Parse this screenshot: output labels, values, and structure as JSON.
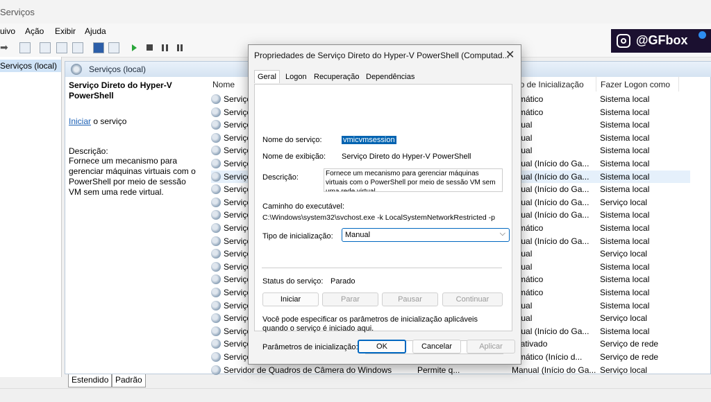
{
  "window": {
    "title": "Serviços"
  },
  "menu": [
    "uivo",
    "Ação",
    "Exibir",
    "Ajuda"
  ],
  "tree": {
    "selected": "Serviços (local)"
  },
  "panel": {
    "header": "Serviços (local)"
  },
  "description_pane": {
    "service_title": "Serviço Direto do Hyper-V PowerShell",
    "start_link": "Iniciar",
    "start_suffix": "o serviço",
    "desc_label": "Descrição:",
    "desc_text": "Fornece um mecanismo para gerenciar máquinas virtuais com o PowerShell por meio de sessão VM sem uma rede virtual."
  },
  "table": {
    "headers": {
      "name": "Nome",
      "startup": "po de Inicialização",
      "logon": "Fazer Logon como"
    },
    "rows": [
      {
        "name": "Serviço",
        "startup": "tomático",
        "logon": "Sistema local"
      },
      {
        "name": "Serviço",
        "startup": "tomático",
        "logon": "Sistema local"
      },
      {
        "name": "Serviço",
        "startup": "anual",
        "logon": "Sistema local"
      },
      {
        "name": "Serviço",
        "startup": "anual",
        "logon": "Sistema local"
      },
      {
        "name": "Serviço",
        "startup": "anual",
        "logon": "Sistema local"
      },
      {
        "name": "Serviço",
        "startup": "anual (Início do Ga...",
        "logon": "Sistema local"
      },
      {
        "name": "Serviço",
        "startup": "anual (Início do Ga...",
        "logon": "Sistema local"
      },
      {
        "name": "Serviço",
        "startup": "anual (Início do Ga...",
        "logon": "Sistema local"
      },
      {
        "name": "Serviço",
        "startup": "anual (Início do Ga...",
        "logon": "Serviço local"
      },
      {
        "name": "Serviço",
        "startup": "anual (Início do Ga...",
        "logon": "Sistema local"
      },
      {
        "name": "Serviço",
        "startup": "tomático",
        "logon": "Sistema local"
      },
      {
        "name": "Serviço",
        "startup": "anual (Início do Ga...",
        "logon": "Sistema local"
      },
      {
        "name": "Serviço",
        "startup": "anual",
        "logon": "Serviço local"
      },
      {
        "name": "Serviço",
        "startup": "anual",
        "logon": "Sistema local"
      },
      {
        "name": "Serviço",
        "startup": "tomático",
        "logon": "Sistema local"
      },
      {
        "name": "Serviço",
        "startup": "tomático",
        "logon": "Sistema local"
      },
      {
        "name": "Serviço",
        "startup": "anual",
        "logon": "Sistema local"
      },
      {
        "name": "Serviço",
        "startup": "anual",
        "logon": "Serviço local"
      },
      {
        "name": "Serviço",
        "startup": "anual (Início do Ga...",
        "logon": "Sistema local"
      },
      {
        "name": "Serviço",
        "startup": "esativado",
        "logon": "Serviço de rede"
      },
      {
        "name": "Serviço",
        "startup": "tomático (Início d...",
        "logon": "Serviço de rede"
      },
      {
        "name": "Servidor de Quadros de Câmera do Windows",
        "status": "Permite q...",
        "startup": "Manual (Início do Ga...",
        "logon": "Serviço local"
      }
    ]
  },
  "bottom_tabs": [
    "Estendido",
    "Padrão"
  ],
  "badge": {
    "text": "@GFbox"
  },
  "dialog": {
    "title": "Propriedades de Serviço Direto do Hyper-V PowerShell (Computad...",
    "close": "✕",
    "tabs": [
      "Geral",
      "Logon",
      "Recuperação",
      "Dependências"
    ],
    "service_name_label": "Nome do serviço:",
    "service_name": "vmicvmsession",
    "display_name_label": "Nome de exibição:",
    "display_name": "Serviço Direto do Hyper-V PowerShell",
    "description_label": "Descrição:",
    "description": "Fornece um mecanismo para gerenciar máquinas virtuais com o PowerShell por meio de sessão VM sem uma rede virtual.",
    "path_label": "Caminho do executável:",
    "path": "C:\\Windows\\system32\\svchost.exe -k LocalSystemNetworkRestricted -p",
    "startup_type_label": "Tipo de inicialização:",
    "startup_type": "Manual",
    "status_label": "Status do serviço:",
    "status": "Parado",
    "btn_start": "Iniciar",
    "btn_stop": "Parar",
    "btn_pause": "Pausar",
    "btn_continue": "Continuar",
    "params_hint": "Você pode especificar os parâmetros de inicialização aplicáveis quando o serviço é iniciado aqui.",
    "params_label": "Parâmetros de inicialização:",
    "ok": "OK",
    "cancel": "Cancelar",
    "apply": "Aplicar"
  }
}
